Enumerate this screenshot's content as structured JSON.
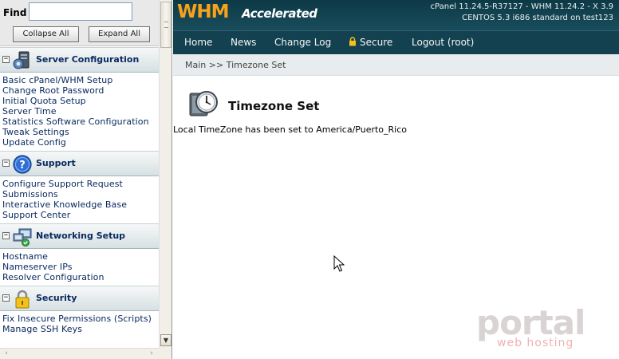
{
  "sidebar": {
    "find_label": "Find",
    "find_value": "",
    "collapse_label": "Collapse All",
    "expand_label": "Expand All",
    "toggle_symbol": "−",
    "sections": [
      {
        "title": "Server Configuration",
        "icon": "server-config-icon",
        "links": [
          "Basic cPanel/WHM Setup",
          "Change Root Password",
          "Initial Quota Setup",
          "Server Time",
          "Statistics Software Configuration",
          "Tweak Settings",
          "Update Config"
        ]
      },
      {
        "title": "Support",
        "icon": "support-question-icon",
        "links": [
          "Configure Support Request Submissions",
          "Interactive Knowledge Base",
          "Support Center"
        ]
      },
      {
        "title": "Networking Setup",
        "icon": "networking-icon",
        "links": [
          "Hostname",
          "Nameserver IPs",
          "Resolver Configuration"
        ]
      },
      {
        "title": "Security",
        "icon": "padlock-icon",
        "links": [
          "Fix Insecure Permissions (Scripts)",
          "Manage SSH Keys"
        ]
      }
    ]
  },
  "header": {
    "logo_primary": "WHM",
    "logo_secondary": "Accelerated",
    "version_line1": "cPanel 11.24.5-R37127 - WHM 11.24.2 - X 3.9",
    "version_line2": "CENTOS 5.3 i686 standard on test123"
  },
  "nav": {
    "home": "Home",
    "news": "News",
    "changelog": "Change Log",
    "secure": "Secure",
    "logout": "Logout (root)"
  },
  "breadcrumb": "Main >> Timezone Set",
  "page": {
    "title": "Timezone Set",
    "message": "Local TimeZone has been set to America/Puerto_Rico"
  },
  "watermark": {
    "brand": "portal",
    "sub": "web hosting"
  },
  "colors": {
    "banner": "#0d3946",
    "logo_orange": "#f6a21b",
    "link_blue": "#0a2a60",
    "section_header": "#d6e0e3"
  }
}
